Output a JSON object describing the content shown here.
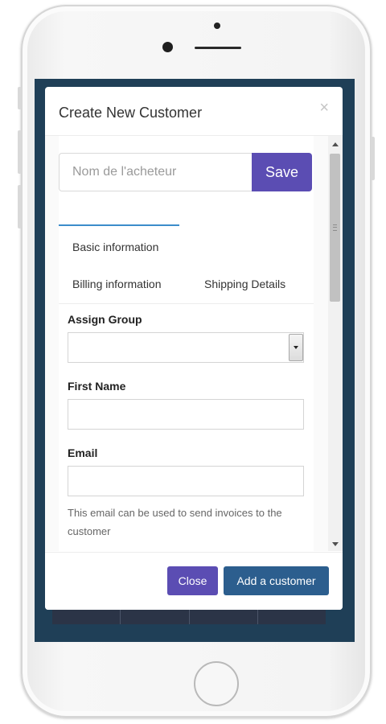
{
  "modal": {
    "title": "Create New Customer",
    "close_symbol": "×",
    "buyer_name": {
      "placeholder": "Nom de l'acheteur",
      "value": ""
    },
    "save_label": "Save",
    "tabs": [
      {
        "label": "Basic information",
        "active": true
      },
      {
        "label": "Billing information",
        "active": false
      },
      {
        "label": "Shipping Details",
        "active": false
      }
    ],
    "form": {
      "assign_group_label": "Assign Group",
      "assign_group_value": "",
      "first_name_label": "First Name",
      "first_name_value": "",
      "email_label": "Email",
      "email_value": "",
      "email_help": "This email can be used to send invoices to the customer"
    },
    "footer": {
      "close_label": "Close",
      "add_label": "Add a customer"
    }
  },
  "colors": {
    "primary_purple": "#5b4db3",
    "primary_blue": "#2c5e8e",
    "active_tab_border": "#3c8dcb",
    "screen_background": "#1f3f57"
  },
  "icons": [
    "close-icon",
    "dropdown-arrow-icon",
    "scroll-up-icon",
    "scroll-down-icon"
  ]
}
